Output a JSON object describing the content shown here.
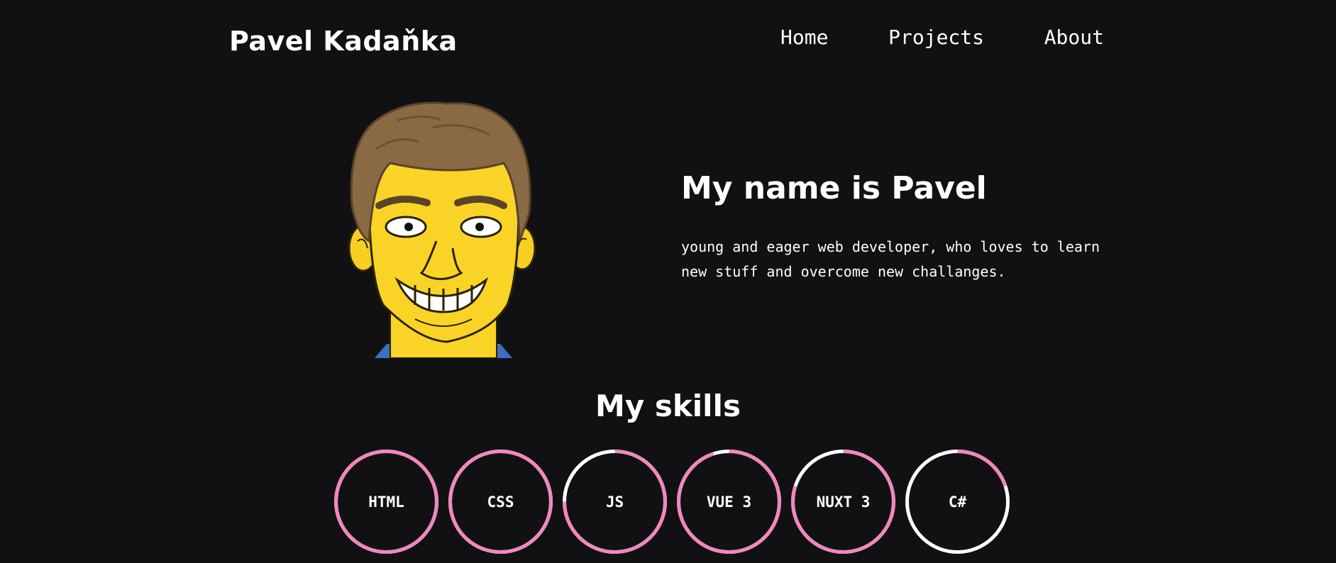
{
  "header": {
    "logo": "Pavel Kadaňka",
    "nav": [
      {
        "label": "Home"
      },
      {
        "label": "Projects"
      },
      {
        "label": "About"
      }
    ]
  },
  "hero": {
    "avatar_icon": "cartoon-avatar",
    "title": "My name is Pavel",
    "description": "young and eager web developer, who loves to learn new stuff and overcome new challanges."
  },
  "skills": {
    "title": "My skills",
    "accent_color": "#f287c0",
    "track_color": "#ffffff",
    "items": [
      {
        "label": "HTML",
        "level": 1.0
      },
      {
        "label": "CSS",
        "level": 1.0
      },
      {
        "label": "JS",
        "level": 0.75
      },
      {
        "label": "VUE 3",
        "level": 0.95
      },
      {
        "label": "NUXT 3",
        "level": 0.8
      },
      {
        "label": "C#",
        "level": 0.2
      }
    ]
  }
}
